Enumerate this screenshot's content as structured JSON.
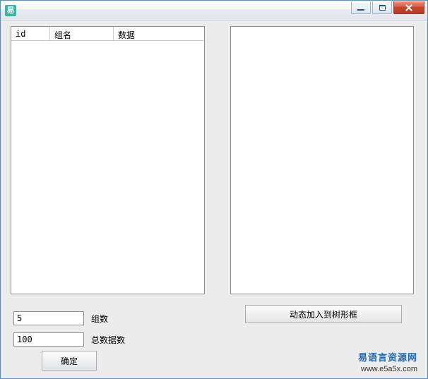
{
  "window": {
    "title": "",
    "icon_text": "易"
  },
  "list": {
    "columns": [
      "id",
      "组名",
      "数据"
    ]
  },
  "inputs": {
    "group_count": {
      "value": "5",
      "label": "组数"
    },
    "total_count": {
      "value": "100",
      "label": "总数据数"
    }
  },
  "buttons": {
    "ok": "确定",
    "add_tree": "动态加入到树形框"
  },
  "footer": {
    "brand": "易语言资源网",
    "url": "www.e5a5x.com"
  }
}
